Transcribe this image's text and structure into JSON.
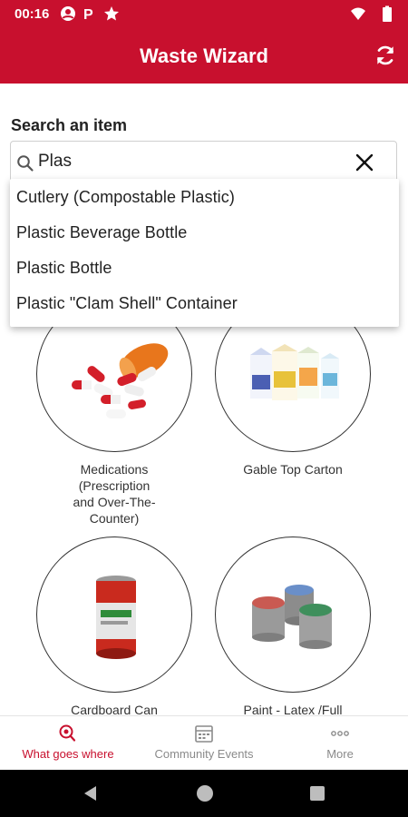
{
  "status_bar": {
    "time": "00:16",
    "icons": [
      "account-circle-icon",
      "parking-icon",
      "star-icon",
      "wifi-icon",
      "battery-icon"
    ]
  },
  "app_bar": {
    "title": "Waste Wizard",
    "action_icon": "refresh-icon"
  },
  "search": {
    "label": "Search an item",
    "value": "Plas",
    "placeholder": ""
  },
  "suggestions": [
    "Cutlery (Compostable Plastic)",
    "Plastic Beverage Bottle",
    "Plastic Bottle",
    "Plastic \"Clam Shell\" Container"
  ],
  "items": [
    {
      "label": "Medications (Prescription and Over-The-Counter)",
      "label_lines": [
        "Medications",
        "(Prescription",
        "and Over-The-",
        "Counter)"
      ],
      "image": "pills-bottle"
    },
    {
      "label": "Gable Top Carton",
      "label_lines": [
        "Gable Top Carton"
      ],
      "image": "cartons"
    },
    {
      "label": "Cardboard Can",
      "label_lines": [
        "Cardboard Can"
      ],
      "image": "can"
    },
    {
      "label": "Paint - Latex/Full",
      "label_lines": [
        "Paint - Latex /Full"
      ],
      "image": "paint-cans"
    }
  ],
  "bottom_nav": [
    {
      "label": "What goes where",
      "icon": "search-magnifier-icon",
      "active": true
    },
    {
      "label": "Community Events",
      "icon": "calendar-icon",
      "active": false
    },
    {
      "label": "More",
      "icon": "more-dots-icon",
      "active": false
    }
  ],
  "colors": {
    "primary": "#c8102e",
    "inactive": "#8a8a8a",
    "text": "#222222"
  }
}
